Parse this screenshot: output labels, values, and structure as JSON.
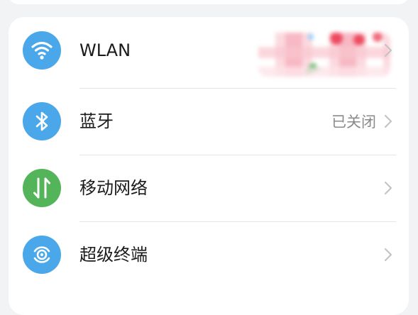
{
  "colors": {
    "wifi_icon_bg": "#4aa8ea",
    "bluetooth_icon_bg": "#4aa8ea",
    "mobile_network_icon_bg": "#54b45a",
    "super_device_icon_bg": "#4aa8ea",
    "label_color": "#1a1a1a",
    "status_color": "#8a8a8a"
  },
  "settings": {
    "items": [
      {
        "label": "WLAN",
        "status": "",
        "icon": "wifi-icon"
      },
      {
        "label": "蓝牙",
        "status": "已关闭",
        "icon": "bluetooth-icon"
      },
      {
        "label": "移动网络",
        "status": "",
        "icon": "mobile-data-icon"
      },
      {
        "label": "超级终端",
        "status": "",
        "icon": "super-device-icon"
      }
    ]
  }
}
